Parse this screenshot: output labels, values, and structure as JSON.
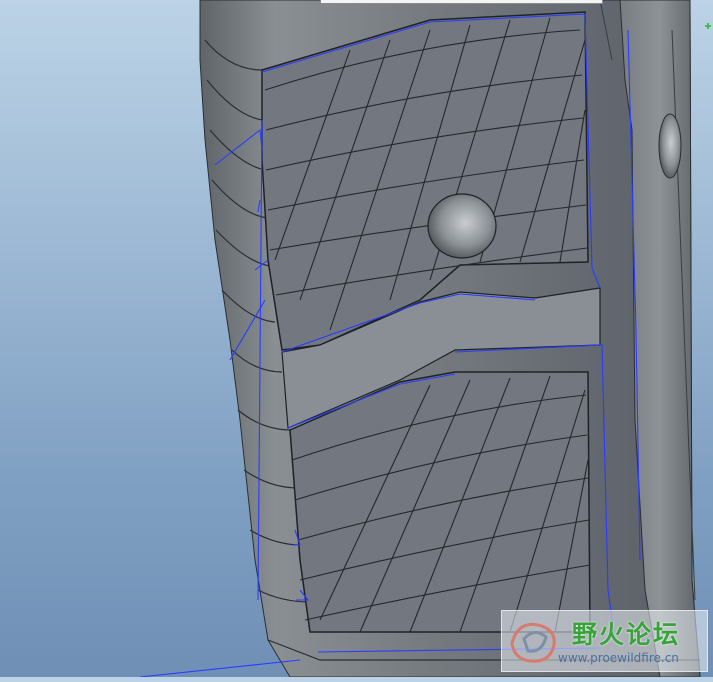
{
  "viewport": {
    "background_top": "#bcd3e6",
    "background_bottom": "#6f8fb5",
    "model_color": "#6e7378",
    "edge_highlight": "#2a3cff"
  },
  "watermark": {
    "title": "野火论坛",
    "url": "www.proewildfire.cn",
    "logo_icon": "wildfire-logo-icon"
  }
}
